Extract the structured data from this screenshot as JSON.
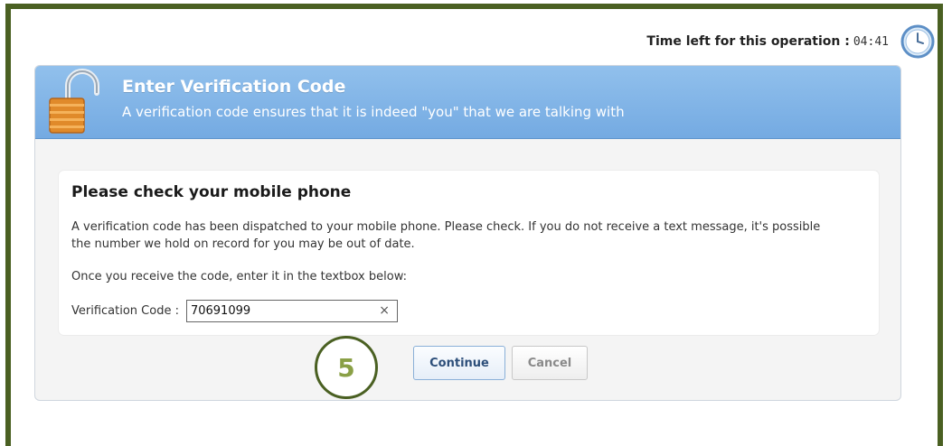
{
  "timer": {
    "label": "Time left for this operation :",
    "value": "04:41",
    "icon": "clock-icon"
  },
  "banner": {
    "title": "Enter Verification Code",
    "subtitle": "A verification code ensures that it is indeed \"you\" that we are talking with",
    "icon": "padlock-icon"
  },
  "card": {
    "title": "Please check your mobile phone",
    "message": "A verification code has been dispatched to your mobile phone. Please check. If you do not receive a text message, it's possible the number we hold on record for you may be out of date.",
    "instruction": "Once you receive the code, enter it in the textbox below:",
    "field_label": "Verification Code :",
    "field_value": "70691099",
    "clear_symbol": "×"
  },
  "buttons": {
    "continue_label": "Continue",
    "cancel_label": "Cancel"
  },
  "step": {
    "number": "5"
  },
  "colors": {
    "frame": "#4a6022",
    "banner": "#7eb2e6",
    "step_number": "#8aa046"
  }
}
